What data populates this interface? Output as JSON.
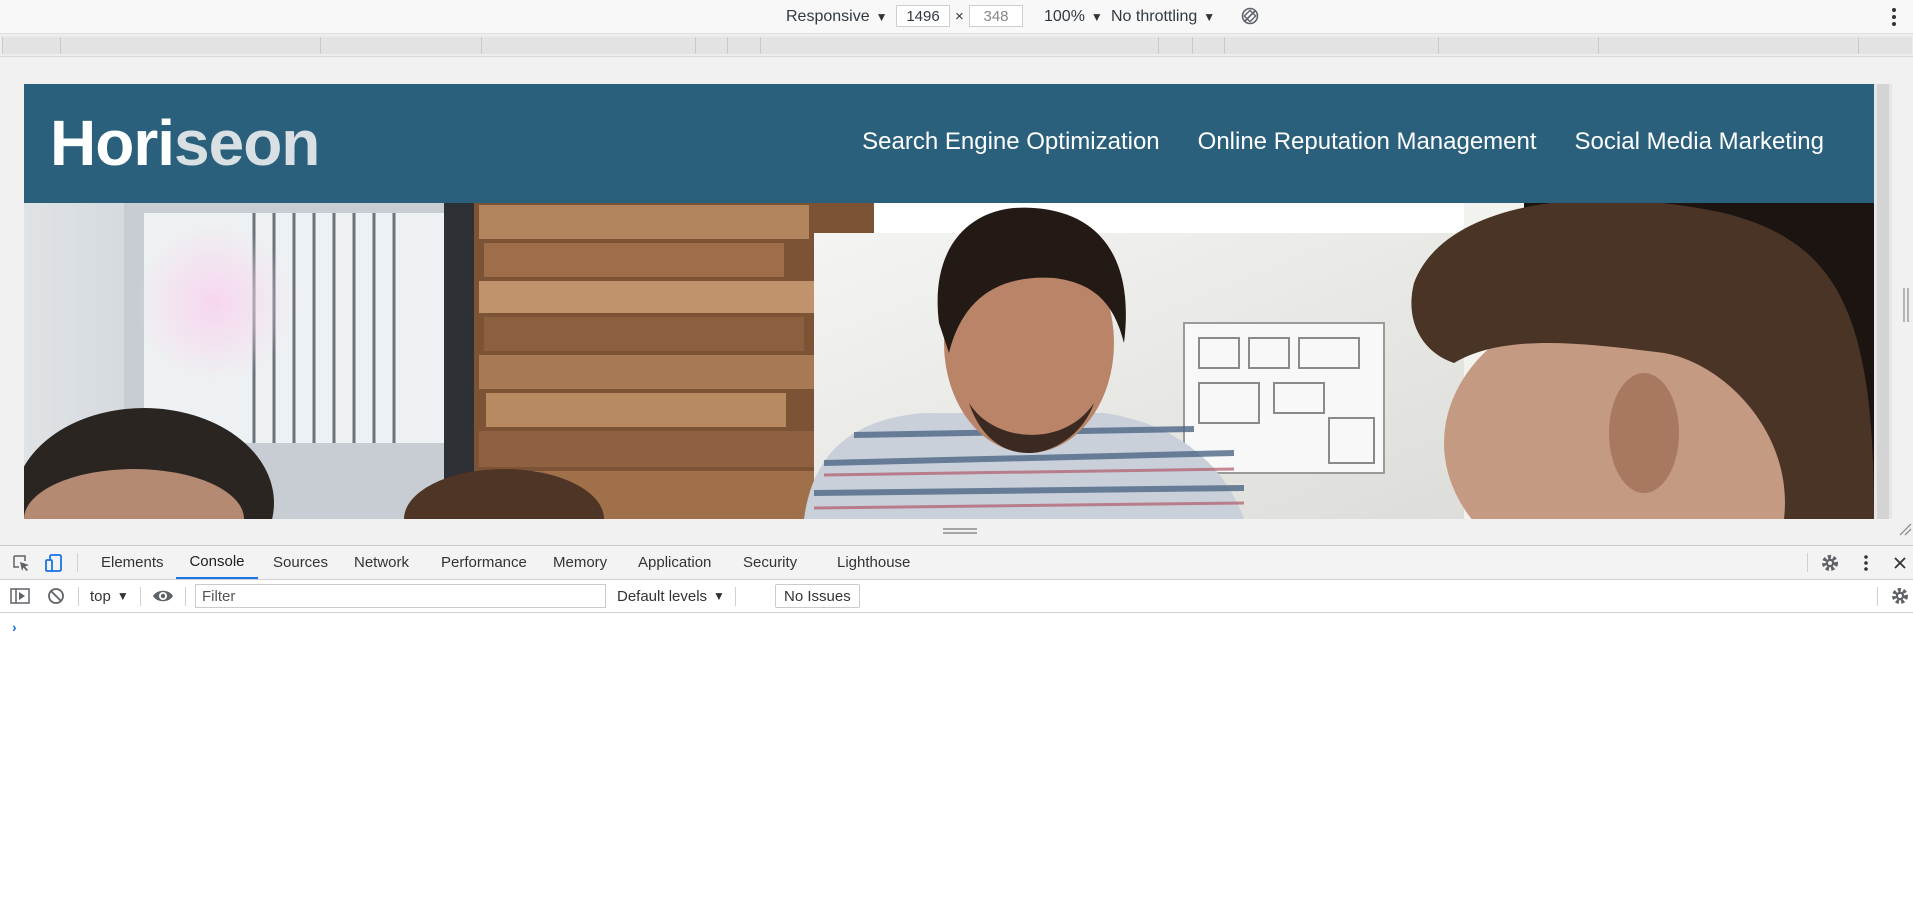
{
  "device_toolbar": {
    "device_mode": "Responsive",
    "width": "1496",
    "height": "348",
    "times": "×",
    "zoom": "100%",
    "throttling": "No throttling",
    "rotate_icon": "rotate-icon",
    "menu_icon": "more-vertical-icon"
  },
  "site": {
    "logo_part1": "Hori",
    "logo_part2": "seon",
    "nav": [
      "Search Engine Optimization",
      "Online Reputation Management",
      "Social Media Marketing"
    ],
    "header_color": "#2a607c",
    "hero_image": "team-meeting-photo"
  },
  "devtools": {
    "tabs": [
      "Elements",
      "Console",
      "Sources",
      "Network",
      "Performance",
      "Memory",
      "Application",
      "Security",
      "Lighthouse"
    ],
    "active_tab": "Console",
    "console": {
      "context": "top",
      "filter_placeholder": "Filter",
      "levels": "Default levels",
      "issues": "No Issues",
      "prompt": "›"
    },
    "accent_color": "#1a73e8"
  }
}
